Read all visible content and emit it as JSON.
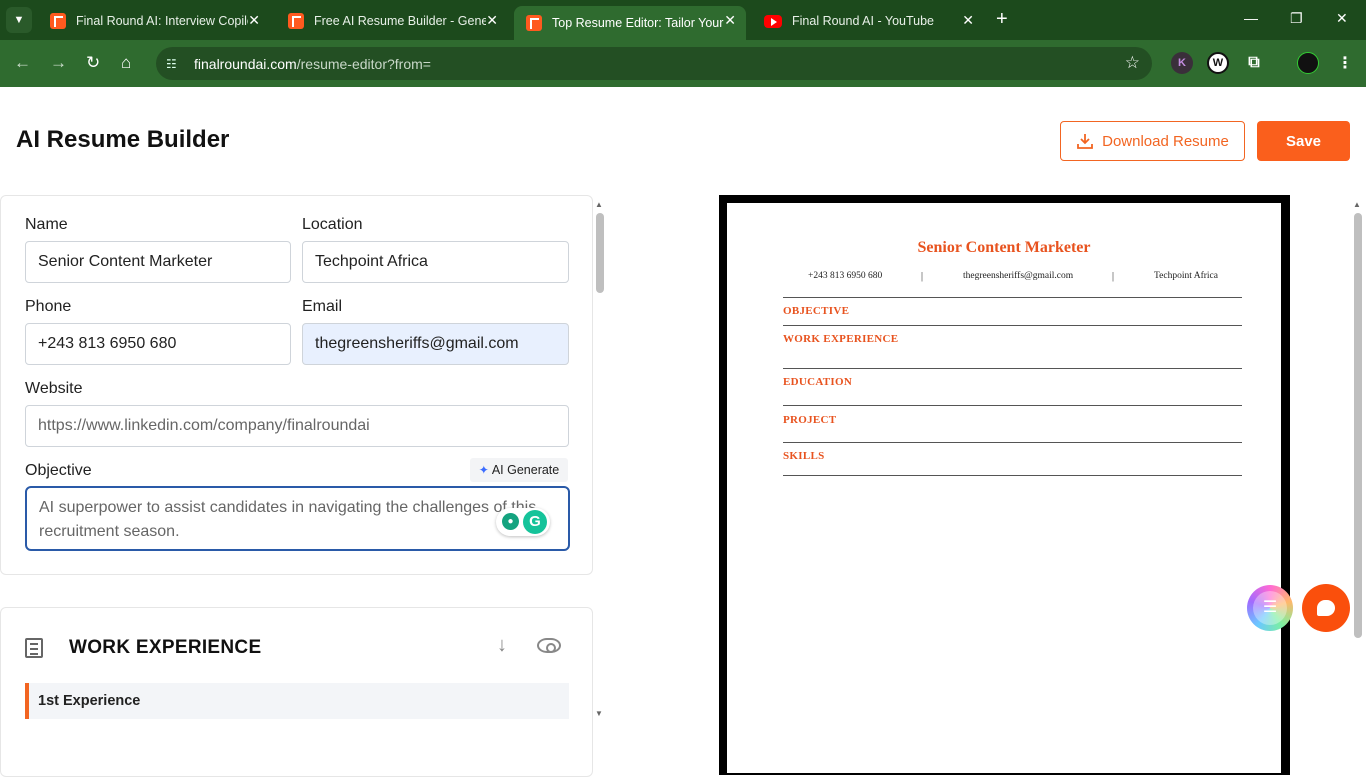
{
  "browser": {
    "tabs": [
      {
        "title": "Final Round AI: Interview Copilot",
        "icon": "final-round-favicon",
        "active": false
      },
      {
        "title": "Free AI Resume Builder - Generate",
        "icon": "final-round-favicon",
        "active": false
      },
      {
        "title": "Top Resume Editor: Tailor Your Resume",
        "icon": "final-round-favicon",
        "active": true
      },
      {
        "title": "Final Round AI - YouTube",
        "icon": "youtube-favicon",
        "active": false
      }
    ],
    "url_domain": "finalroundai.com",
    "url_path": "/resume-editor?from=",
    "extensions": [
      "K",
      "W"
    ]
  },
  "page": {
    "title": "AI Resume Builder",
    "download_label": "Download Resume",
    "save_label": "Save"
  },
  "form": {
    "name_label": "Name",
    "name_value": "Senior Content Marketer",
    "location_label": "Location",
    "location_value": "Techpoint Africa",
    "phone_label": "Phone",
    "phone_value": "+243 813 6950 680",
    "email_label": "Email",
    "email_value": "thegreensheriffs@gmail.com",
    "website_label": "Website",
    "website_placeholder": "https://www.linkedin.com/company/finalroundai",
    "objective_label": "Objective",
    "ai_generate_label": "AI Generate",
    "objective_placeholder": "AI superpower to assist candidates in navigating the challenges of this recruitment season."
  },
  "work_experience": {
    "title": "WORK EXPERIENCE",
    "first_item": "1st Experience"
  },
  "preview": {
    "name": "Senior Content Marketer",
    "phone": "+243 813 6950 680",
    "email": "thegreensheriffs@gmail.com",
    "location": "Techpoint Africa",
    "separator": "|",
    "sections": [
      "OBJECTIVE",
      "WORK EXPERIENCE",
      "EDUCATION",
      "PROJECT",
      "SKILLS"
    ]
  },
  "colors": {
    "accent": "#fa5f1c",
    "browser_frame": "#2f6b2f",
    "resume_heading": "#e8531f"
  }
}
